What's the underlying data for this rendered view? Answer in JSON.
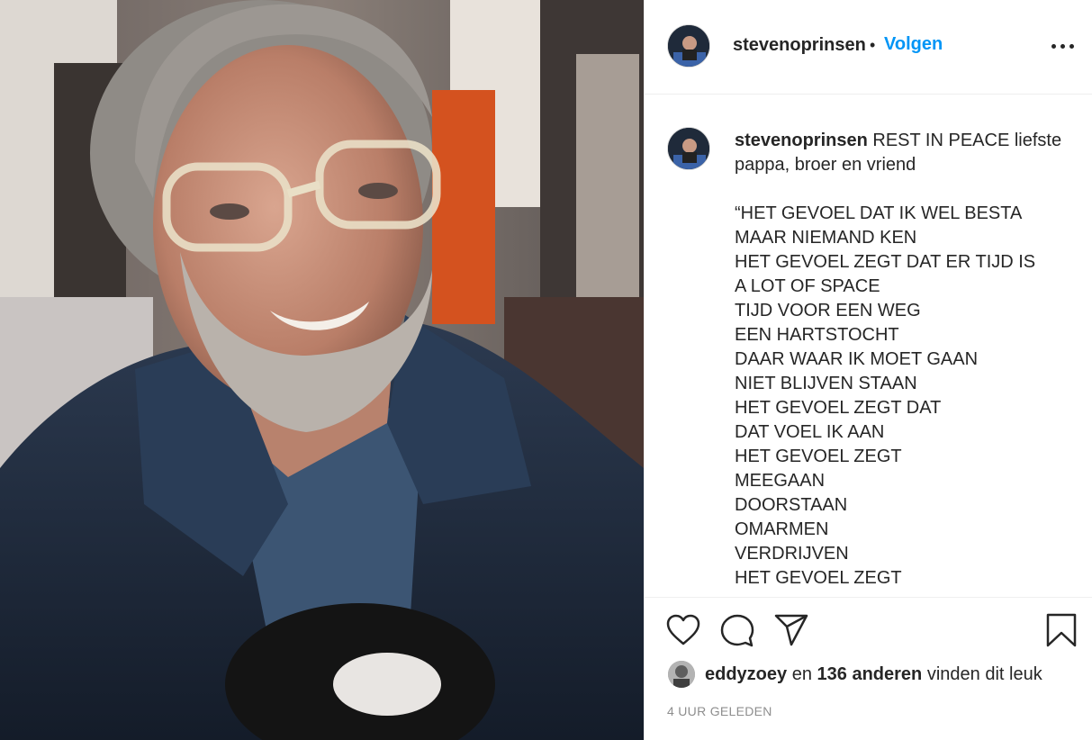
{
  "post": {
    "image_alt": "Portrait of a smiling man with grey hair, beard and clear-framed glasses wearing a dark denim jacket"
  },
  "header": {
    "username": "stevenoprinsen",
    "separator": "•",
    "follow_label": "Volgen",
    "more_icon": "more-horizontal-icon"
  },
  "caption": {
    "username": "stevenoprinsen",
    "intro": "REST IN PEACE liefste pappa, broer en vriend",
    "lines": [
      "“HET GEVOEL DAT IK WEL BESTA",
      "MAAR NIEMAND KEN",
      "HET GEVOEL ZEGT DAT ER TIJD IS",
      "A LOT OF SPACE",
      "TIJD VOOR EEN WEG",
      "EEN HARTSTOCHT",
      "DAAR WAAR IK MOET GAAN",
      "NIET BLIJVEN STAAN",
      "HET GEVOEL ZEGT DAT",
      "DAT VOEL IK AAN",
      "HET GEVOEL ZEGT",
      "MEEGAAN",
      "DOORSTAAN",
      "OMARMEN",
      "VERDRIJVEN",
      "HET GEVOEL ZEGT"
    ]
  },
  "actions": {
    "like_icon": "heart-icon",
    "comment_icon": "comment-icon",
    "share_icon": "paper-plane-icon",
    "save_icon": "bookmark-icon"
  },
  "likes": {
    "user": "eddyzoey",
    "connector": "en",
    "others": "136 anderen",
    "suffix": "vinden dit leuk"
  },
  "timestamp": "4 UUR GELEDEN",
  "colors": {
    "link_blue": "#0095f6",
    "text": "#262626",
    "muted": "#8e8e8e",
    "border": "#efefef"
  }
}
